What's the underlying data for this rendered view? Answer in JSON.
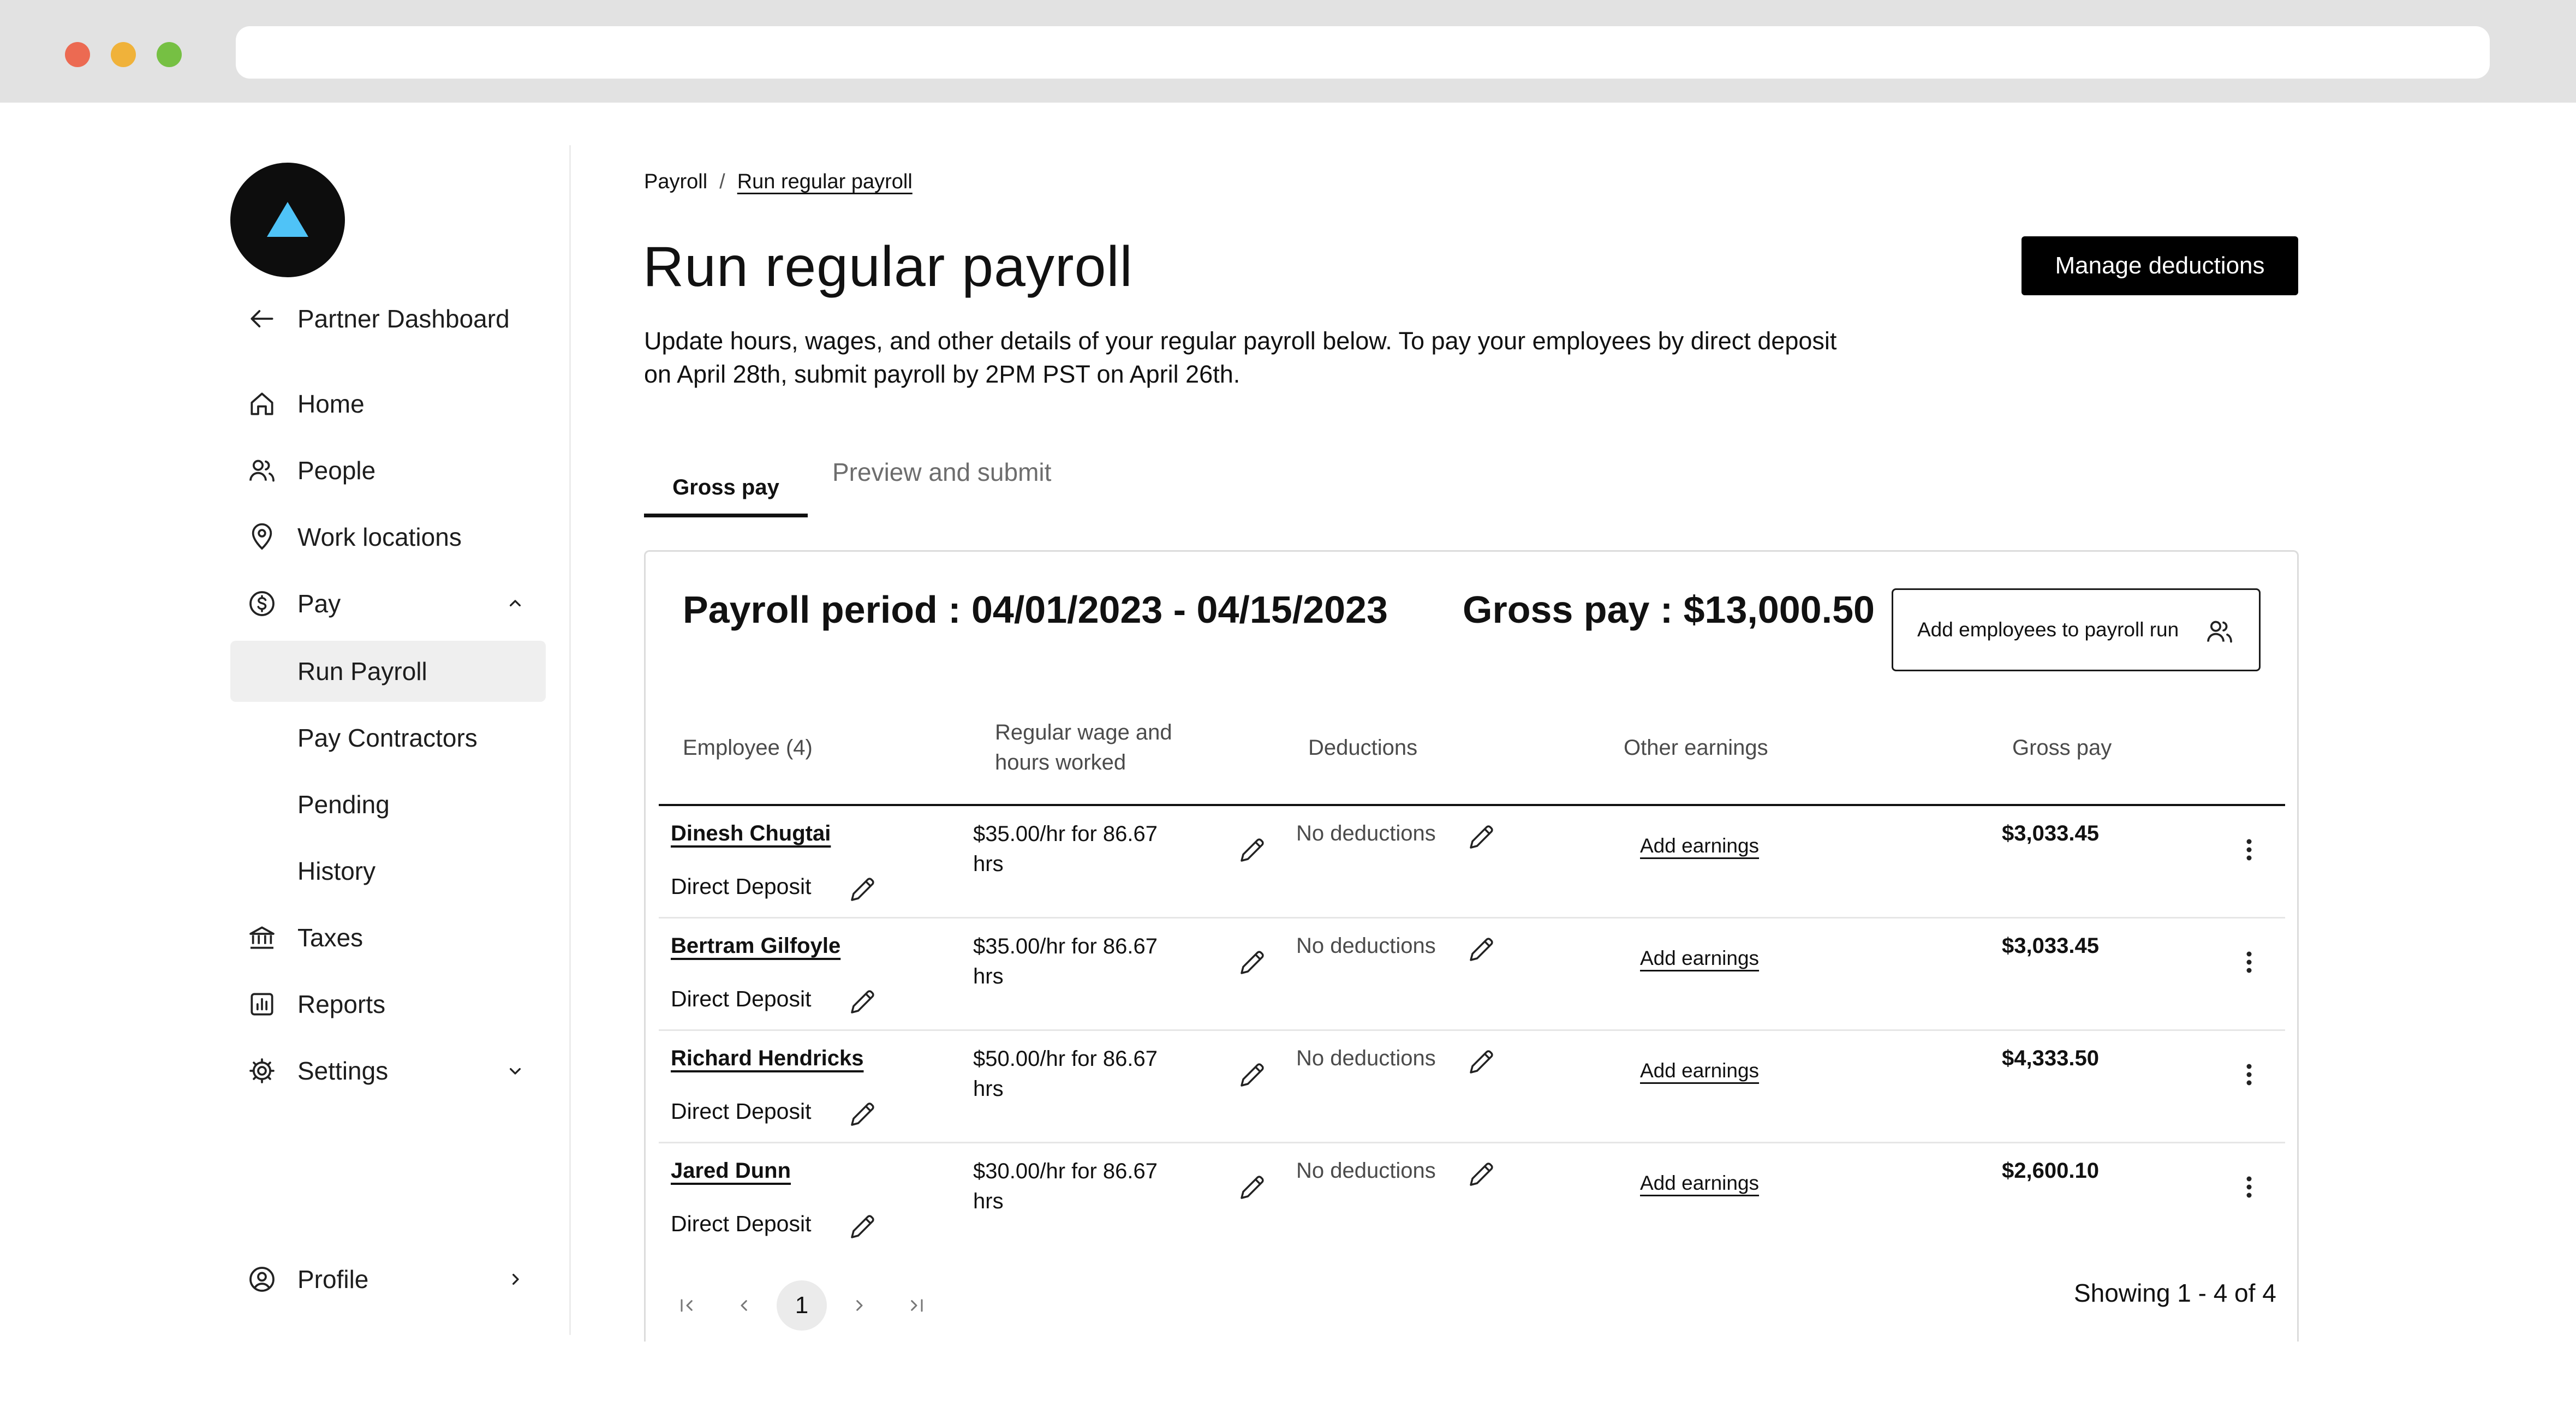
{
  "sidebar": {
    "back_label": "Partner Dashboard",
    "items": [
      {
        "label": "Home"
      },
      {
        "label": "People"
      },
      {
        "label": "Work locations"
      },
      {
        "label": "Pay"
      },
      {
        "label": "Run Payroll"
      },
      {
        "label": "Pay Contractors"
      },
      {
        "label": "Pending"
      },
      {
        "label": "History"
      },
      {
        "label": "Taxes"
      },
      {
        "label": "Reports"
      },
      {
        "label": "Settings"
      }
    ],
    "profile_label": "Profile"
  },
  "breadcrumb": {
    "root": "Payroll",
    "separator": "/",
    "current": "Run regular payroll"
  },
  "header": {
    "title": "Run regular payroll",
    "description": "Update hours, wages, and other details of your regular payroll below. To pay your employees by direct deposit on April 28th, submit payroll by 2PM PST on April 26th.",
    "manage_button": "Manage deductions"
  },
  "tabs": [
    {
      "label": "Gross pay",
      "active": true
    },
    {
      "label": "Preview and submit",
      "active": false
    }
  ],
  "summary": {
    "period": "Payroll period : 04/01/2023 - 04/15/2023",
    "gross_total": "Gross pay : $13,000.50",
    "add_employees_button": "Add employees to payroll run"
  },
  "table": {
    "headers": {
      "employee": "Employee (4)",
      "wage_line1": "Regular wage and",
      "wage_line2": "hours worked",
      "deductions": "Deductions",
      "other_earnings": "Other earnings",
      "gross_pay": "Gross pay"
    },
    "rows": [
      {
        "name": "Dinesh Chugtai",
        "method": "Direct Deposit",
        "wage_line1": "$35.00/hr for 86.67",
        "wage_line2": "hrs",
        "deductions": "No deductions",
        "earnings": "Add earnings",
        "gross": "$3,033.45"
      },
      {
        "name": "Bertram Gilfoyle",
        "method": "Direct Deposit",
        "wage_line1": "$35.00/hr for 86.67",
        "wage_line2": "hrs",
        "deductions": "No deductions",
        "earnings": "Add earnings",
        "gross": "$3,033.45"
      },
      {
        "name": "Richard Hendricks",
        "method": "Direct Deposit",
        "wage_line1": "$50.00/hr for 86.67",
        "wage_line2": "hrs",
        "deductions": "No deductions",
        "earnings": "Add earnings",
        "gross": "$4,333.50"
      },
      {
        "name": "Jared Dunn",
        "method": "Direct Deposit",
        "wage_line1": "$30.00/hr for 86.67",
        "wage_line2": "hrs",
        "deductions": "No deductions",
        "earnings": "Add earnings",
        "gross": "$2,600.10"
      }
    ]
  },
  "pagination": {
    "current_page": "1",
    "showing": "Showing 1 - 4 of 4"
  },
  "icons": {
    "logo": "triangle-logo-icon",
    "back": "arrow-left-icon",
    "edit": "pencil-icon",
    "more": "kebab-icon",
    "add_people": "users-icon"
  },
  "colors": {
    "accent": "#4fc3f7",
    "primary_button": "#000000",
    "active_nav": "#efefef"
  }
}
